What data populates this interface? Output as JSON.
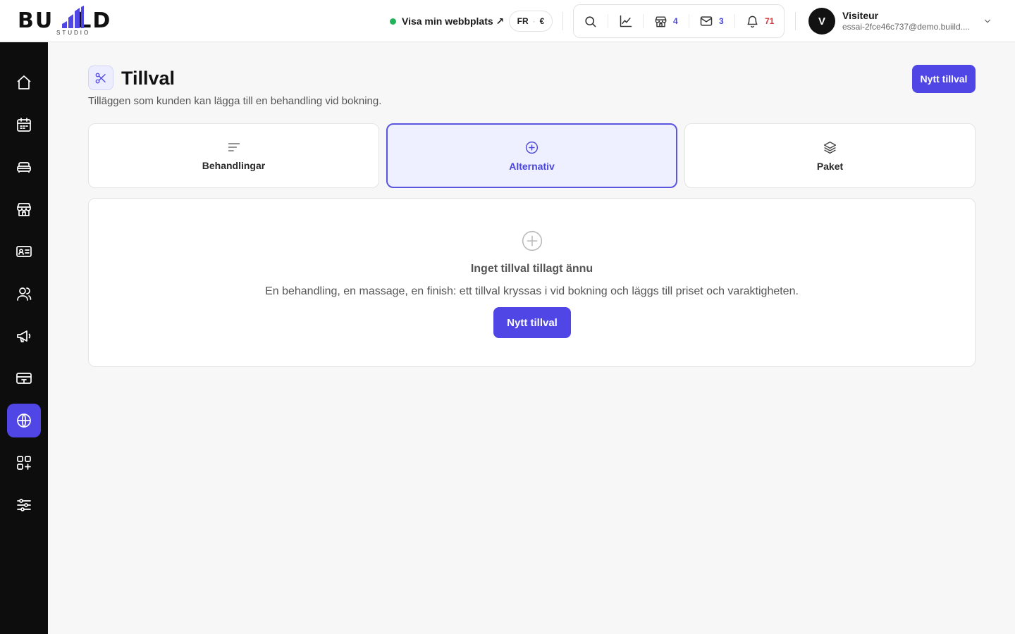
{
  "header": {
    "logo_text": "BUILD",
    "logo_sub": "STUDIO",
    "site_link": "Visa min webbplats ↗",
    "lang": "FR",
    "currency": "€",
    "tools": {
      "stores_count": "4",
      "messages_count": "3",
      "notifications_count": "71"
    },
    "user": {
      "initial": "V",
      "name": "Visiteur",
      "email": "essai-2fce46c737@demo.buiild...."
    }
  },
  "sidebar": {
    "items": [
      {
        "icon": "home-icon"
      },
      {
        "icon": "calendar-icon"
      },
      {
        "icon": "bed-icon"
      },
      {
        "icon": "store-icon"
      },
      {
        "icon": "contact-card-icon"
      },
      {
        "icon": "users-icon"
      },
      {
        "icon": "megaphone-icon"
      },
      {
        "icon": "payment-card-icon"
      },
      {
        "icon": "globe-icon",
        "active": true
      },
      {
        "icon": "apps-add-icon"
      },
      {
        "icon": "sliders-icon"
      }
    ]
  },
  "page": {
    "title": "Tillval",
    "description": "Tilläggen som kunden kan lägga till en behandling vid bokning.",
    "new_button": "Nytt tillval"
  },
  "tabs": [
    {
      "label": "Behandlingar",
      "icon": "list-icon",
      "active": false
    },
    {
      "label": "Alternativ",
      "icon": "plus-circle-icon",
      "active": true
    },
    {
      "label": "Paket",
      "icon": "layers-icon",
      "active": false
    }
  ],
  "empty_state": {
    "title": "Inget tillval tillagt ännu",
    "text": "En behandling, en massage, en finish: ett tillval kryssas i vid bokning och läggs till priset och varaktigheten.",
    "button": "Nytt tillval"
  },
  "colors": {
    "accent": "#4f46e5",
    "sidebar_bg": "#0d0d0d",
    "status_green": "#22b35a",
    "badge_red": "#d63a3a"
  }
}
